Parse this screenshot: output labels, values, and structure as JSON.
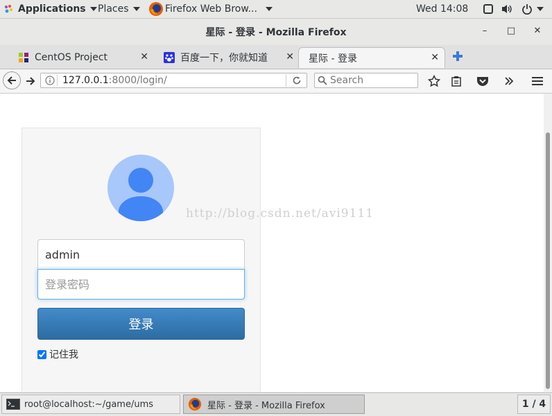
{
  "topbar": {
    "applications": "Applications",
    "places": "Places",
    "active_app": "Firefox Web Brow...",
    "clock": "Wed 14:08"
  },
  "window": {
    "title": "星际 - 登录 - Mozilla Firefox",
    "minimize": "–",
    "maximize": "□",
    "close": "✕"
  },
  "tabs": [
    {
      "label": "CentOS Project",
      "close": "✕"
    },
    {
      "label": "百度一下，你就知道",
      "close": "✕"
    },
    {
      "label": "星际 - 登录",
      "close": "✕"
    }
  ],
  "navbar": {
    "url_host": "127.0.0.1",
    "url_path": ":8000/login/",
    "search_placeholder": "Search"
  },
  "login": {
    "username_value": "admin",
    "password_placeholder": "登录密码",
    "submit_label": "登录",
    "remember_label": "记住我",
    "remember_checked": true
  },
  "watermark": "http://blog.csdn.net/avi9111",
  "taskbar": {
    "terminal": "root@localhost:~/game/ums",
    "firefox": "星际 - 登录 - Mozilla Firefox",
    "workspace": "1 / 4"
  },
  "colors": {
    "primary_button": "#337ab7",
    "focus_border": "#66afe9",
    "avatar_light": "#a8c7fa",
    "avatar_dark": "#4285f4"
  }
}
